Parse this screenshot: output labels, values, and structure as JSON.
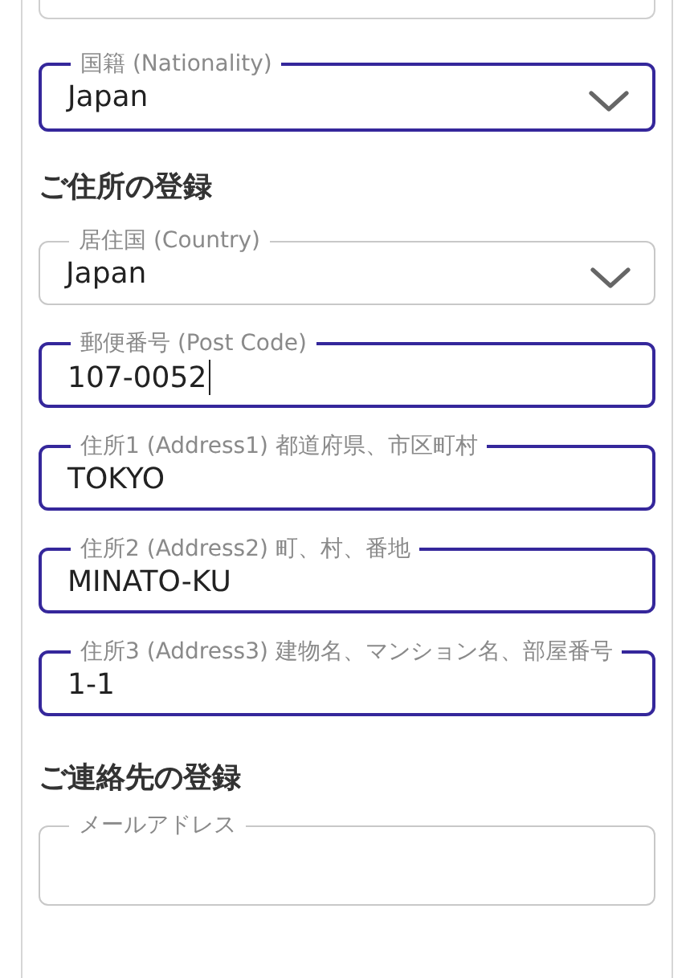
{
  "nationality_field": {
    "kind": "select",
    "label": "国籍 (Nationality)",
    "value": "Japan",
    "highlighted": true,
    "focused": false
  },
  "address_section": {
    "heading": "ご住所の登録",
    "fields": [
      {
        "kind": "select",
        "label": "居住国 (Country)",
        "value": "Japan",
        "highlighted": false,
        "focused": false
      },
      {
        "kind": "text",
        "label": "郵便番号 (Post Code)",
        "value": "107-0052",
        "highlighted": true,
        "focused": true
      },
      {
        "kind": "text",
        "label": "住所1 (Address1) 都道府県、市区町村",
        "value": "TOKYO",
        "highlighted": true,
        "focused": false
      },
      {
        "kind": "text",
        "label": "住所2 (Address2) 町、村、番地",
        "value": "MINATO-KU",
        "highlighted": true,
        "focused": false
      },
      {
        "kind": "text",
        "label": "住所3 (Address3) 建物名、マンション名、部屋番号",
        "value": "1-1",
        "highlighted": true,
        "focused": false
      }
    ]
  },
  "contact_section": {
    "heading": "ご連絡先の登録",
    "fields": [
      {
        "label": "メールアドレス",
        "highlighted": false
      }
    ]
  }
}
